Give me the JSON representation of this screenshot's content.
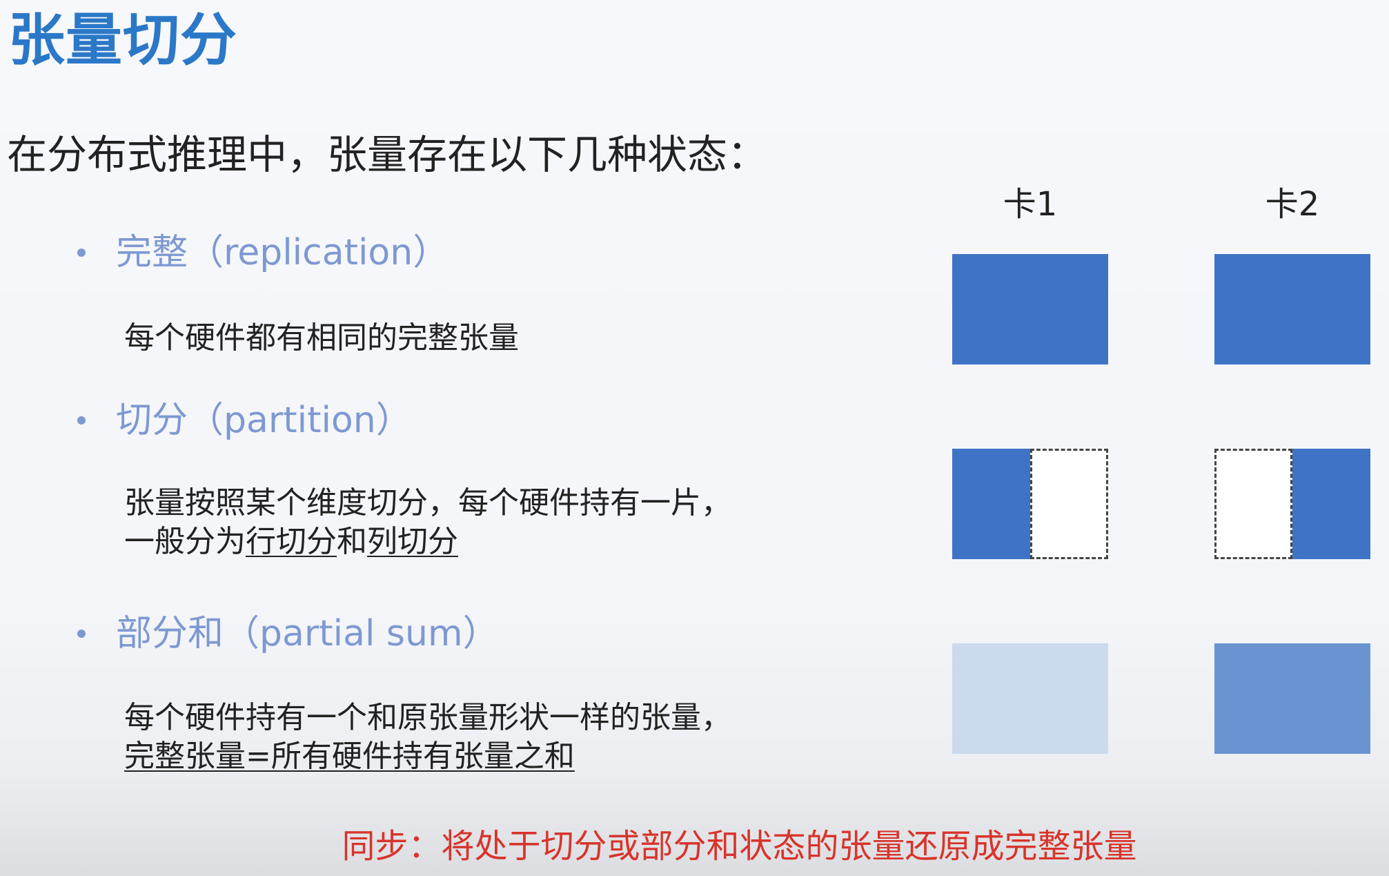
{
  "slide": {
    "title": "张量切分",
    "intro": "在分布式推理中，张量存在以下几种状态：",
    "cards": [
      "卡1",
      "卡2"
    ],
    "states": [
      {
        "name": "完整（replication）",
        "desc_lines": [
          "每个硬件都有相同的完整张量"
        ]
      },
      {
        "name": "切分（partition）",
        "desc_line1": "张量按照某个维度切分，每个硬件持有一片，",
        "desc_line2_prefix": "一般分为",
        "desc_line2_row": "行切分",
        "desc_line2_and": "和",
        "desc_line2_col": "列切分"
      },
      {
        "name": "部分和（partial sum）",
        "desc_line1": "每个硬件持有一个和原张量形状一样的张量，",
        "desc_line2": "完整张量=所有硬件持有张量之和"
      }
    ],
    "footer": "同步：将处于切分或部分和状态的张量还原成完整张量",
    "colors": {
      "title": "#2a78c7",
      "bullet": "#7e99d2",
      "block_full": "#3e73c5",
      "block_partial_light": "#ccdaee",
      "block_partial_mid": "#6a93d2",
      "footer": "#d9342b"
    }
  }
}
